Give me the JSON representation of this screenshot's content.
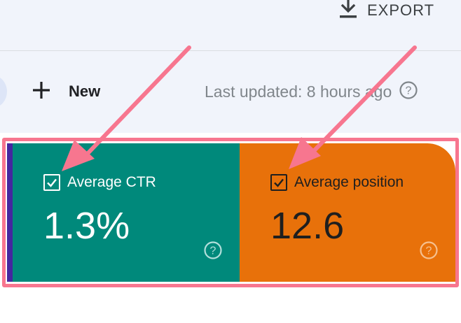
{
  "header": {
    "export_label": "EXPORT"
  },
  "toolbar": {
    "new_label": "New",
    "last_updated": "Last updated: 8 hours ago"
  },
  "metrics": [
    {
      "label": "Average CTR",
      "value": "1.3%",
      "checked": true,
      "color": "#00897b"
    },
    {
      "label": "Average position",
      "value": "12.6",
      "checked": true,
      "color": "#e8710a"
    }
  ],
  "colors": {
    "accent_strip": "#4527a0",
    "highlight": "#f7768f",
    "background_top": "#f1f4fb"
  },
  "icons": [
    "download-icon",
    "plus-icon",
    "help-icon",
    "checkbox-checked-icon",
    "annotation-arrow"
  ]
}
